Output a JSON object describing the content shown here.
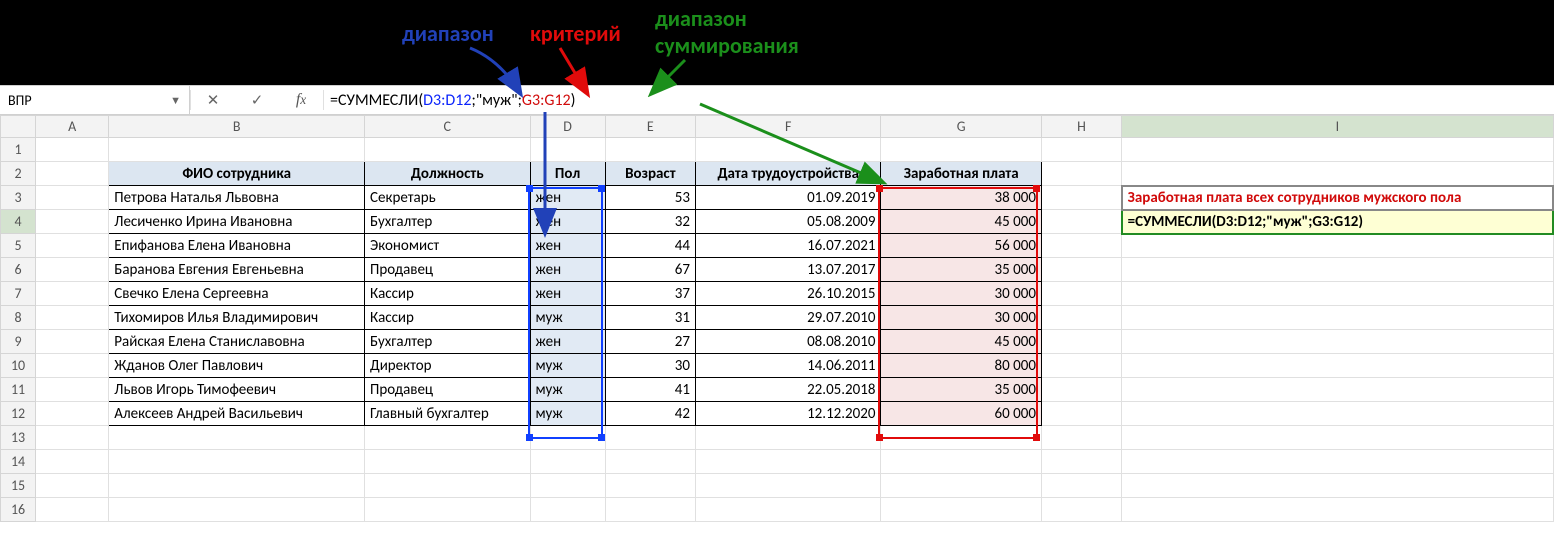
{
  "annot": {
    "range": "диапазон",
    "criterion": "критерий",
    "sumrange1": "диапазон",
    "sumrange2": "суммирования"
  },
  "namebox": "ВПР",
  "formula": {
    "full": "=СУММЕСЛИ(D3:D12;\"муж\";G3:G12)",
    "pre": "=СУММЕСЛИ(",
    "arg1": "D3:D12",
    "sep1": ";",
    "arg2": "\"муж\"",
    "sep2": ";",
    "arg3": "G3:G12",
    "post": ")"
  },
  "cols": [
    "A",
    "B",
    "C",
    "D",
    "E",
    "F",
    "G",
    "H",
    "I"
  ],
  "rows": [
    "1",
    "2",
    "3",
    "4",
    "5",
    "6",
    "7",
    "8",
    "9",
    "10",
    "11",
    "12",
    "13",
    "14",
    "15",
    "16"
  ],
  "header": {
    "b": "ФИО сотрудника",
    "c": "Должность",
    "d": "Пол",
    "e": "Возраст",
    "f": "Дата трудоустройства",
    "g": "Заработная плата"
  },
  "data": [
    {
      "b": "Петрова Наталья Львовна",
      "c": "Секретарь",
      "d": "жен",
      "e": "53",
      "f": "01.09.2019",
      "g": "38 000"
    },
    {
      "b": "Лесиченко Ирина Ивановна",
      "c": "Бухгалтер",
      "d": "жен",
      "e": "32",
      "f": "05.08.2009",
      "g": "45 000"
    },
    {
      "b": "Епифанова Елена Ивановна",
      "c": "Экономист",
      "d": "жен",
      "e": "44",
      "f": "16.07.2021",
      "g": "56 000"
    },
    {
      "b": "Баранова Евгения Евгеньевна",
      "c": "Продавец",
      "d": "жен",
      "e": "67",
      "f": "13.07.2017",
      "g": "35 000"
    },
    {
      "b": "Свечко Елена Сергеевна",
      "c": "Кассир",
      "d": "жен",
      "e": "37",
      "f": "26.10.2015",
      "g": "30 000"
    },
    {
      "b": "Тихомиров Илья Владимирович",
      "c": "Кассир",
      "d": "муж",
      "e": "31",
      "f": "29.07.2010",
      "g": "30 000"
    },
    {
      "b": "Райская Елена Станиславовна",
      "c": "Бухгалтер",
      "d": "жен",
      "e": "27",
      "f": "08.08.2010",
      "g": "45 000"
    },
    {
      "b": "Жданов Олег Павлович",
      "c": "Директор",
      "d": "муж",
      "e": "30",
      "f": "14.06.2011",
      "g": "80 000"
    },
    {
      "b": "Львов Игорь Тимофеевич",
      "c": "Продавец",
      "d": "муж",
      "e": "41",
      "f": "22.05.2018",
      "g": "35 000"
    },
    {
      "b": "Алексеев Андрей Васильевич",
      "c": "Главный бухгалтер",
      "d": "муж",
      "e": "42",
      "f": "12.12.2020",
      "g": "60 000"
    }
  ],
  "side": {
    "title": "Заработная плата всех сотрудников мужского пола",
    "formula": "=СУММЕСЛИ(D3:D12;\"муж\";G3:G12)"
  }
}
